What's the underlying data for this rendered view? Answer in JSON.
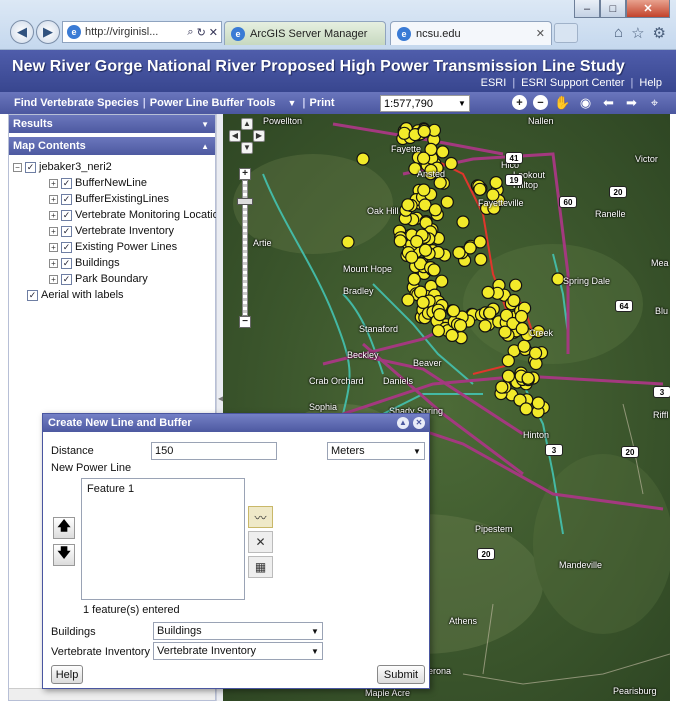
{
  "browser": {
    "address": "http://virginisl...",
    "tabs": [
      {
        "label": "ArcGIS Server Manager"
      },
      {
        "label": "ncsu.edu"
      }
    ],
    "window_buttons": [
      "–",
      "□",
      "✕"
    ]
  },
  "banner": {
    "title": "New River Gorge National River Proposed High Power Transmission Line Study",
    "links": [
      "ESRI",
      "ESRI Support Center",
      "Help"
    ]
  },
  "toolbar": {
    "items": [
      "Find Vertebrate Species",
      "Power Line Buffer Tools",
      "Print"
    ],
    "scale": "1:577,790"
  },
  "panel": {
    "results_label": "Results",
    "map_contents_label": "Map Contents",
    "root_layer": "jebaker3_neri2",
    "layers": [
      "BufferNewLine",
      "BufferExistingLines",
      "Vertebrate Monitoring Locatio",
      "Vertebrate Inventory",
      "Existing Power Lines",
      "Buildings",
      "Park Boundary"
    ],
    "basemap": "Aerial with labels"
  },
  "map": {
    "labels": [
      "Powellton",
      "Fayette",
      "Nallen",
      "Hico",
      "Lookout",
      "Hilltop",
      "Victor",
      "Ansted",
      "Oak Hill",
      "Fayetteville",
      "Ranelle",
      "Artie",
      "Mount Hope",
      "Bradley",
      "Spring Dale",
      "Mea",
      "Stanaford",
      "Blu",
      "Beckley",
      "Beaver",
      "Crab Orchard",
      "Daniels",
      "Sophia",
      "Shady Spring",
      "Hinton",
      "Riffl",
      "Pipestem",
      "Mandeville",
      "Athens",
      "Lerona",
      "Maple Acre",
      "Pearisburg",
      "Creek"
    ],
    "shields": [
      "41",
      "19",
      "20",
      "60",
      "64",
      "3",
      "3",
      "20",
      "20"
    ],
    "colors": {
      "terrain": "#3d5a2c",
      "marker": "#f2ea2a",
      "line": "#a3397f",
      "buffer": "#44c3b1",
      "boundary": "#e0362c"
    }
  },
  "dialog": {
    "title": "Create New Line and Buffer",
    "distance_label": "Distance",
    "distance_value": "150",
    "unit": "Meters",
    "new_line_label": "New Power Line",
    "features": [
      "Feature 1"
    ],
    "count_text": "1 feature(s) entered",
    "buildings_label": "Buildings",
    "buildings_value": "Buildings",
    "vertebrate_label": "Vertebrate Inventory",
    "vertebrate_value": "Vertebrate Inventory",
    "help_label": "Help",
    "submit_label": "Submit"
  }
}
